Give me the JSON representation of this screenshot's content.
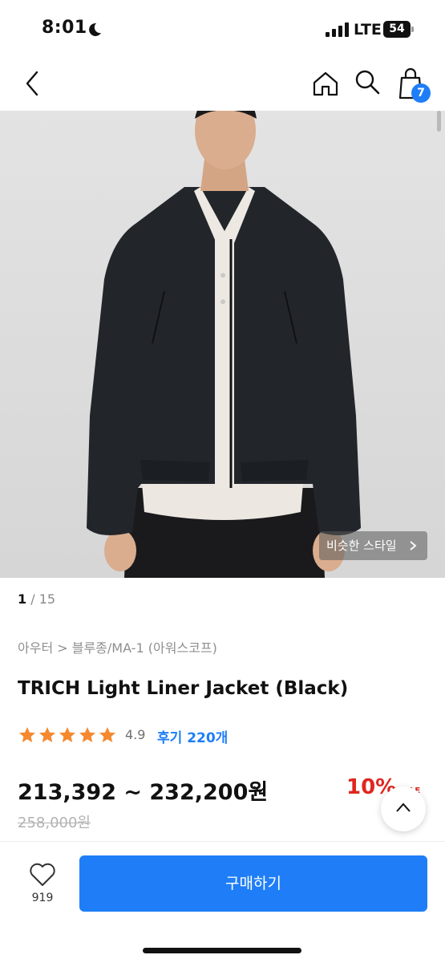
{
  "status_bar": {
    "time": "8:01",
    "network": "LTE",
    "battery": "54"
  },
  "nav": {
    "cart_count": "7"
  },
  "gallery": {
    "current": "1",
    "separator": " / ",
    "total": "15",
    "similar_style_label": "비슷한 스타일"
  },
  "product": {
    "breadcrumb": "아우터 > 블루종/MA-1 (아워스코프)",
    "title": "TRICH Light Liner Jacket (Black)",
    "rating": "4.9",
    "review_label": "후기 220개",
    "star_count": 5,
    "price_range": "213,392 ~ 232,200원",
    "discount": "10%",
    "discount_tail": "SALE",
    "original_price": "258,000원"
  },
  "bottom_bar": {
    "like_count": "919",
    "buy_label": "구매하기"
  },
  "colors": {
    "accent": "#1f7ef7",
    "discount": "#e0271f",
    "star": "#f5892f"
  }
}
